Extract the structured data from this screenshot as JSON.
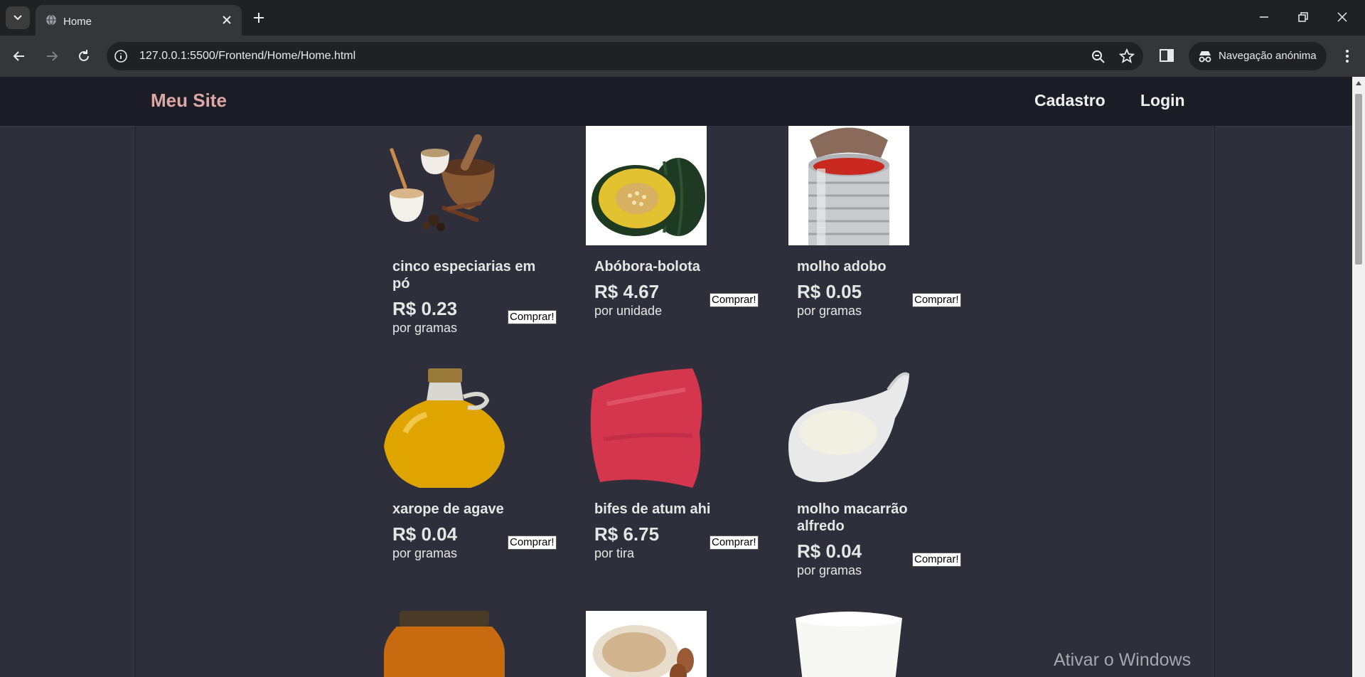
{
  "browser": {
    "tab_title": "Home",
    "url": "127.0.0.1:5500/Frontend/Home/Home.html",
    "incognito_label": "Navegação anónima"
  },
  "site": {
    "brand": "Meu Site",
    "nav": [
      "Cadastro",
      "Login"
    ]
  },
  "products": [
    {
      "name": "cinco especiarias em pó",
      "price": "R$ 0.23",
      "unit": "por gramas",
      "buy": "Comprar!",
      "image": "spices-image"
    },
    {
      "name": "Abóbora-bolota",
      "price": "R$ 4.67",
      "unit": "por unidade",
      "buy": "Comprar!",
      "image": "acorn-squash-image"
    },
    {
      "name": "molho adobo",
      "price": "R$ 0.05",
      "unit": "por gramas",
      "buy": "Comprar!",
      "image": "tomato-can-image"
    },
    {
      "name": "xarope de agave",
      "price": "R$ 0.04",
      "unit": "por gramas",
      "buy": "Comprar!",
      "image": "agave-syrup-image"
    },
    {
      "name": "bifes de atum ahi",
      "price": "R$ 6.75",
      "unit": "por tira",
      "buy": "Comprar!",
      "image": "tuna-steak-image"
    },
    {
      "name": "molho macarrão alfredo",
      "price": "R$ 0.04",
      "unit": "por gramas",
      "buy": "Comprar!",
      "image": "alfredo-sauce-image"
    }
  ],
  "watermark": "Ativar o Windows",
  "colors": {
    "brand": "#dba8a4",
    "page_bg": "#2e2f3a",
    "nav_bg": "#1b1c25"
  }
}
